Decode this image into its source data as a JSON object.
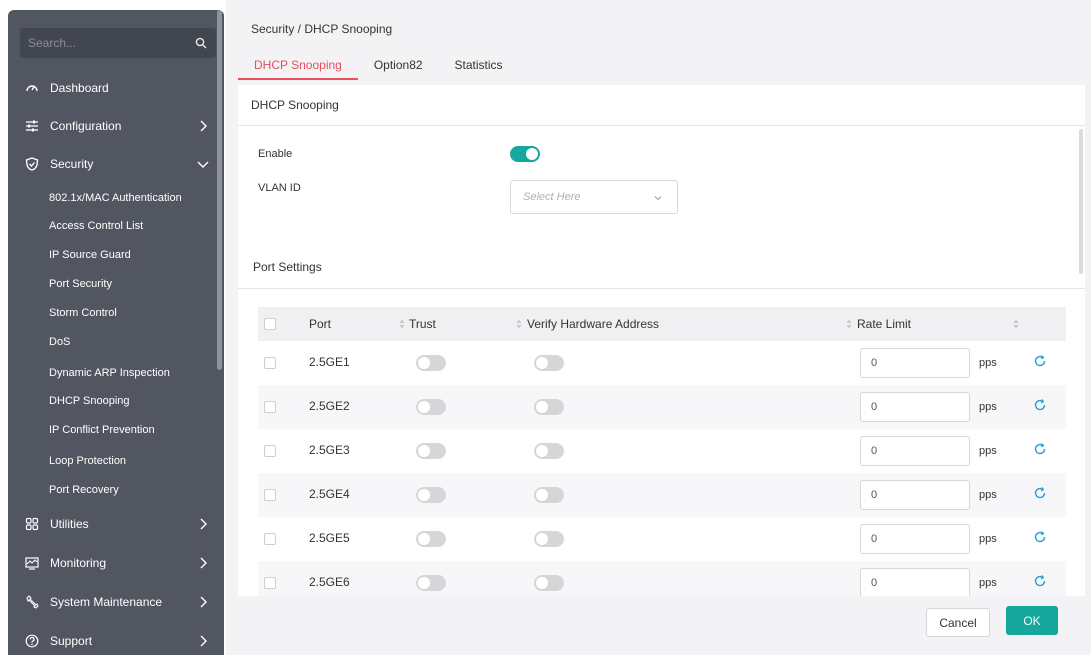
{
  "sidebar": {
    "search_placeholder": "Search...",
    "nav": [
      {
        "label": "Dashboard",
        "icon": "dashboard-icon"
      },
      {
        "label": "Configuration",
        "icon": "sliders-icon"
      },
      {
        "label": "Security",
        "icon": "shield-icon"
      },
      {
        "label": "Utilities",
        "icon": "grid-icon"
      },
      {
        "label": "Monitoring",
        "icon": "monitor-icon"
      },
      {
        "label": "System Maintenance",
        "icon": "wrench-icon"
      },
      {
        "label": "Support",
        "icon": "help-icon"
      }
    ],
    "security_items": [
      "802.1x/MAC Authentication",
      "Access Control List",
      "IP Source Guard",
      "Port Security",
      "Storm Control",
      "DoS",
      "Dynamic ARP Inspection",
      "DHCP Snooping",
      "IP Conflict Prevention",
      "Loop Protection",
      "Port Recovery"
    ]
  },
  "breadcrumb": "Security / DHCP Snooping",
  "tabs": [
    "DHCP Snooping",
    "Option82",
    "Statistics"
  ],
  "active_tab": "DHCP Snooping",
  "card": {
    "title": "DHCP Snooping",
    "enable_label": "Enable",
    "enable_state": true,
    "vlan_label": "VLAN ID",
    "vlan_placeholder": "Select Here",
    "port_settings_title": "Port Settings"
  },
  "table": {
    "headers": {
      "port": "Port",
      "trust": "Trust",
      "verify": "Verify Hardware Address",
      "rate": "Rate Limit"
    },
    "unit": "pps",
    "rows": [
      {
        "port": "2.5GE1",
        "trust": false,
        "verify": false,
        "rate": "0"
      },
      {
        "port": "2.5GE2",
        "trust": false,
        "verify": false,
        "rate": "0"
      },
      {
        "port": "2.5GE3",
        "trust": false,
        "verify": false,
        "rate": "0"
      },
      {
        "port": "2.5GE4",
        "trust": false,
        "verify": false,
        "rate": "0"
      },
      {
        "port": "2.5GE5",
        "trust": false,
        "verify": false,
        "rate": "0"
      },
      {
        "port": "2.5GE6",
        "trust": false,
        "verify": false,
        "rate": "0"
      }
    ]
  },
  "buttons": {
    "cancel": "Cancel",
    "ok": "OK"
  },
  "colors": {
    "sidebar_bg": "#525660",
    "accent_teal": "#16a79d",
    "active_tab_red": "#e6505e",
    "refresh_blue": "#2a9fd8"
  }
}
